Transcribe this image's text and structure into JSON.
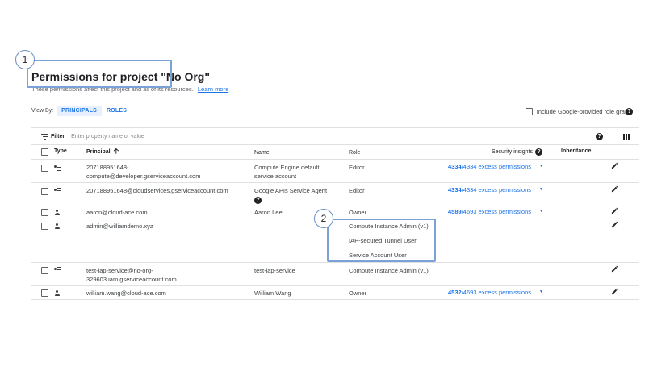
{
  "page": {
    "title": "Permissions for project \"No Org\"",
    "subtitle": "These permissions affect this project and all of its resources.",
    "learn_more": "Learn more"
  },
  "callouts": [
    "1",
    "2"
  ],
  "view_by": {
    "label": "View By:",
    "options": [
      "PRINCIPALS",
      "ROLES"
    ],
    "selected": "PRINCIPALS"
  },
  "include_google_grants": {
    "label": "Include Google-provided role grants",
    "checked": false
  },
  "filter": {
    "label": "Filter",
    "placeholder": "Enter property name or value"
  },
  "table": {
    "headers": {
      "type": "Type",
      "principal": "Principal",
      "name": "Name",
      "role": "Role",
      "security_insights": "Security insights",
      "inheritance": "Inheritance"
    },
    "rows": [
      {
        "type": "service-account",
        "principal": [
          "207188951648-",
          "compute@developer.gserviceaccount.com"
        ],
        "name": [
          "Compute Engine default",
          "service account"
        ],
        "roles": [
          "Editor"
        ],
        "insight_count": "4334",
        "insight_rest": "/4334 excess permissions"
      },
      {
        "type": "service-account",
        "principal": [
          "207188951648@cloudservices.gserviceaccount.com"
        ],
        "name": [
          "Google APIs Service Agent"
        ],
        "roles": [
          "Editor"
        ],
        "insight_count": "4334",
        "insight_rest": "/4334 excess permissions"
      },
      {
        "type": "user",
        "principal": [
          "aaron@cloud-ace.com"
        ],
        "name": [
          "Aaron Lee"
        ],
        "roles": [
          "Owner"
        ],
        "insight_count": "4589",
        "insight_rest": "/4693 excess permissions"
      },
      {
        "type": "user",
        "principal": [
          "admin@williamdemo.xyz"
        ],
        "name": [],
        "roles": [
          "Compute Instance Admin (v1)",
          "IAP-secured Tunnel User",
          "Service Account User"
        ],
        "insight_count": "",
        "insight_rest": ""
      },
      {
        "type": "service-account",
        "principal": [
          "test-iap-service@no-org-",
          "329603.iam.gserviceaccount.com"
        ],
        "name": [
          "test-iap-service"
        ],
        "roles": [
          "Compute Instance Admin (v1)"
        ],
        "insight_count": "",
        "insight_rest": ""
      },
      {
        "type": "user",
        "principal": [
          "william.wang@cloud-ace.com"
        ],
        "name": [
          "William Wang"
        ],
        "roles": [
          "Owner"
        ],
        "insight_count": "4532",
        "insight_rest": "/4693 excess permissions"
      }
    ]
  },
  "colors": {
    "accent": "#1a73e8",
    "callout_border": "#7aa2d8",
    "divider": "#e0e0e0"
  },
  "icons": {
    "service_account": "service-account-icon",
    "user": "person-icon",
    "edit": "pencil-icon",
    "help": "help-icon",
    "columns": "column-display-icon",
    "filter": "filter-icon",
    "sort": "arrow-up-icon",
    "dropdown": "triangle-down-icon"
  }
}
